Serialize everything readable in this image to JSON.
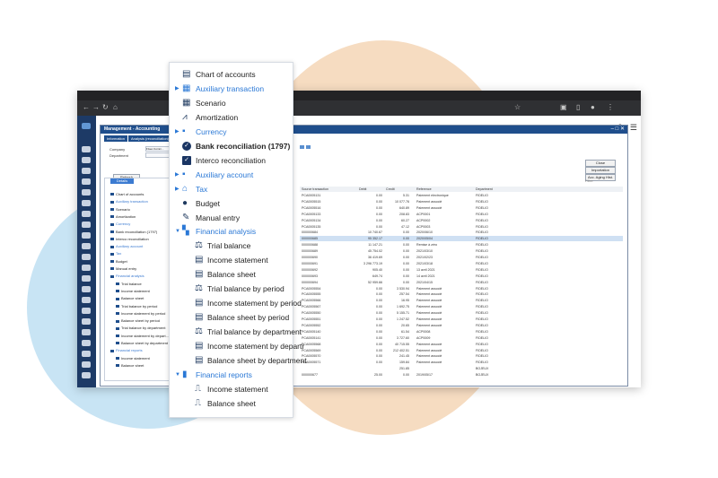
{
  "window": {
    "title": "Management - Accounting",
    "tabs": [
      "Information",
      "Analysis (reconciliation)"
    ]
  },
  "form": {
    "company_label": "Company",
    "company_value": "Fixeo Comm...",
    "department_label": "Department"
  },
  "buttons": {
    "refresh": "Refresh",
    "close": "Close",
    "importation": "Importation",
    "aging": "Acc. Aging Hist."
  },
  "left_panel": {
    "header": "Details",
    "items": [
      {
        "label": "Chart of accounts",
        "blue": false
      },
      {
        "label": "Auxiliary transaction",
        "blue": true
      },
      {
        "label": "Scenario",
        "blue": false
      },
      {
        "label": "Amortization",
        "blue": false
      },
      {
        "label": "Currency",
        "blue": true
      },
      {
        "label": "Bank reconciliation (1797)",
        "blue": false
      },
      {
        "label": "Interco reconciliation",
        "blue": false
      },
      {
        "label": "Auxiliary account",
        "blue": true
      },
      {
        "label": "Tax",
        "blue": true
      },
      {
        "label": "Budget",
        "blue": false
      },
      {
        "label": "Manual entry",
        "blue": false
      },
      {
        "label": "Financial analysis",
        "blue": true
      },
      {
        "label": "Trial balance",
        "blue": false
      },
      {
        "label": "Income statement",
        "blue": false
      },
      {
        "label": "Balance sheet",
        "blue": false
      },
      {
        "label": "Trial balance by period",
        "blue": false
      },
      {
        "label": "Income statement by period",
        "blue": false
      },
      {
        "label": "Balance sheet by period",
        "blue": false
      },
      {
        "label": "Trial balance by department",
        "blue": false
      },
      {
        "label": "Income statement by depart...",
        "blue": false
      },
      {
        "label": "Balance sheet by department",
        "blue": false
      },
      {
        "label": "Financial reports",
        "blue": true
      },
      {
        "label": "Income statement",
        "blue": false
      },
      {
        "label": "Balance sheet",
        "blue": false
      }
    ]
  },
  "grid": {
    "filter_placeholder": "Filter",
    "columns": [
      "Source transaction",
      "Debit",
      "Credit",
      "Reference",
      "Department"
    ],
    "rows": [
      [
        "PCA0005131",
        "0.00",
        "5.31",
        "Paiement electronique",
        "FIDELIO"
      ],
      [
        "PCA0005515",
        "0.00",
        "10 077.76",
        "Paiement associé",
        "FIDELIO"
      ],
      [
        "PCA0005516",
        "0.00",
        "640.89",
        "Paiement associé",
        "FIDELIO"
      ],
      [
        "PCA0005133",
        "0.00",
        "208.83",
        "ACP0001",
        "FIDELIO"
      ],
      [
        "PCA0005134",
        "0.00",
        "60.27",
        "ACP0002",
        "FIDELIO"
      ],
      [
        "PCA0005135",
        "0.00",
        "47.12",
        "ACP0003",
        "FIDELIO"
      ],
      [
        "000000684",
        "10 740.67",
        "0.00",
        "2020/06/10",
        "FIDELIO"
      ],
      [
        "000000685",
        "95 352.17",
        "0.00",
        "2020/05/04",
        "FIDELIO"
      ],
      [
        "000000688",
        "11 147.21",
        "0.00",
        "Remise à zéro",
        "FIDELIO"
      ],
      [
        "000000689",
        "45 754.02",
        "0.00",
        "2021/03/10",
        "FIDELIO"
      ],
      [
        "000000690",
        "36 419.69",
        "0.00",
        "2021/02/23",
        "FIDELIO"
      ],
      [
        "000000691",
        "3 296 773.19",
        "0.00",
        "2021/03/18",
        "FIDELIO"
      ],
      [
        "000000692",
        "905.40",
        "0.00",
        "13 avril 2021",
        "FIDELIO"
      ],
      [
        "000000693",
        "649.74",
        "0.00",
        "14 avril 2021",
        "FIDELIO"
      ],
      [
        "000000694",
        "52 959.66",
        "0.00",
        "2021/04/15",
        "FIDELIO"
      ],
      [
        "PCA0005554",
        "0.00",
        "3 530.94",
        "Paiement associé",
        "FIDELIO"
      ],
      [
        "PCA0005555",
        "0.00",
        "257.54",
        "Paiement associé",
        "FIDELIO"
      ],
      [
        "PCA0005566",
        "0.00",
        "16.95",
        "Paiement associé",
        "FIDELIO"
      ],
      [
        "PCA0005567",
        "0.00",
        "1 692.75",
        "Paiement associé",
        "FIDELIO"
      ],
      [
        "PCA0005550",
        "0.00",
        "5 155.71",
        "Paiement associé",
        "FIDELIO"
      ],
      [
        "PCA0005551",
        "0.00",
        "1 247.52",
        "Paiement associé",
        "FIDELIO"
      ],
      [
        "PCA0005552",
        "0.00",
        "20.65",
        "Paiement associé",
        "FIDELIO"
      ],
      [
        "PCA0005140",
        "0.00",
        "61.54",
        "ACP0008",
        "FIDELIO"
      ],
      [
        "PCA0005141",
        "0.00",
        "3 727.60",
        "ACP0009",
        "FIDELIO"
      ],
      [
        "PCA0005568",
        "0.00",
        "40 715.55",
        "Paiement associé",
        "FIDELIO"
      ],
      [
        "PCA0005569",
        "0.00",
        "212 402.51",
        "Paiement associé",
        "FIDELIO"
      ],
      [
        "PCA0005570",
        "0.00",
        "241.45",
        "Paiement associé",
        "FIDELIO"
      ],
      [
        "PCA0005571",
        "0.00",
        "159.84",
        "Paiement associé",
        "FIDELIO"
      ],
      [
        "",
        "",
        "251.85",
        "",
        "BOJEUX"
      ],
      [
        "000000677",
        "25.00",
        "0.00",
        "2019/05/17",
        "BOJEUX"
      ]
    ],
    "selected_row": 7
  },
  "menu": {
    "items": [
      {
        "label": "Chart of accounts",
        "icon": "chart-of-accounts-icon",
        "glyph": "▤",
        "caret": false,
        "style": "normal"
      },
      {
        "label": "Auxiliary transaction",
        "icon": "auxiliary-transaction-icon",
        "glyph": "▦",
        "caret": true,
        "style": "blue"
      },
      {
        "label": "Scenario",
        "icon": "scenario-icon",
        "glyph": "▦",
        "caret": false,
        "style": "normal"
      },
      {
        "label": "Amortization",
        "icon": "amortization-icon",
        "glyph": "⩘",
        "caret": false,
        "style": "normal"
      },
      {
        "label": "Currency",
        "icon": "currency-icon",
        "glyph": "▪",
        "caret": true,
        "style": "blue"
      },
      {
        "label": "Bank reconciliation (1797)",
        "icon": "check-circle-icon",
        "glyph": "✓",
        "caret": false,
        "style": "bold-check"
      },
      {
        "label": "Interco reconciliation",
        "icon": "check-box-icon",
        "glyph": "✓",
        "caret": false,
        "style": "box"
      },
      {
        "label": "Auxiliary account",
        "icon": "auxiliary-account-icon",
        "glyph": "▪",
        "caret": true,
        "style": "blue"
      },
      {
        "label": "Tax",
        "icon": "tax-bank-icon",
        "glyph": "⌂",
        "caret": true,
        "style": "blue"
      },
      {
        "label": "Budget",
        "icon": "money-bag-icon",
        "glyph": "●",
        "caret": false,
        "style": "normal"
      },
      {
        "label": "Manual entry",
        "icon": "pen-icon",
        "glyph": "✎",
        "caret": false,
        "style": "normal"
      },
      {
        "label": "Financial analysis",
        "icon": "financial-analysis-icon",
        "glyph": "▚",
        "caret": "open",
        "style": "blue"
      },
      {
        "label": "Trial balance",
        "icon": "scale-icon",
        "glyph": "⚖",
        "caret": false,
        "style": "sub"
      },
      {
        "label": "Income statement",
        "icon": "document-icon",
        "glyph": "▤",
        "caret": false,
        "style": "sub"
      },
      {
        "label": "Balance sheet",
        "icon": "document-icon",
        "glyph": "▤",
        "caret": false,
        "style": "sub"
      },
      {
        "label": "Trial balance by period",
        "icon": "scale-icon",
        "glyph": "⚖",
        "caret": false,
        "style": "sub"
      },
      {
        "label": "Income statement by period",
        "icon": "document-icon",
        "glyph": "▤",
        "caret": false,
        "style": "sub"
      },
      {
        "label": "Balance sheet by period",
        "icon": "document-icon",
        "glyph": "▤",
        "caret": false,
        "style": "sub"
      },
      {
        "label": "Trial balance by department",
        "icon": "scale-icon",
        "glyph": "⚖",
        "caret": false,
        "style": "sub"
      },
      {
        "label": "Income statement by departr",
        "icon": "document-icon",
        "glyph": "▤",
        "caret": false,
        "style": "sub"
      },
      {
        "label": "Balance sheet by department",
        "icon": "document-icon",
        "glyph": "▤",
        "caret": false,
        "style": "sub"
      },
      {
        "label": "Financial reports",
        "icon": "financial-reports-icon",
        "glyph": "▮",
        "caret": "open",
        "style": "blue"
      },
      {
        "label": "Income statement",
        "icon": "step-chart-icon",
        "glyph": "⎍",
        "caret": false,
        "style": "sub"
      },
      {
        "label": "Balance sheet",
        "icon": "step-chart-icon",
        "glyph": "⎍",
        "caret": false,
        "style": "sub"
      }
    ]
  },
  "colors": {
    "accent_blue": "#2a78d6",
    "navy": "#1a3563",
    "orange_blob": "#f6dcc1",
    "blue_blob": "#c8e4f4"
  }
}
